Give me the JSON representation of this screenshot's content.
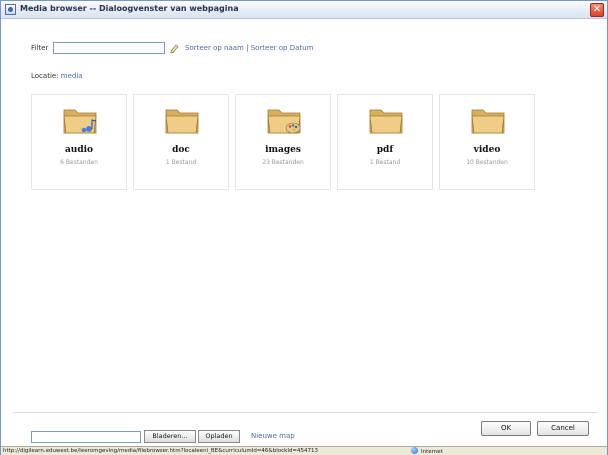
{
  "window": {
    "title": "Media browser -- Dialoogvenster van webpagina",
    "close_glyph": "✕"
  },
  "filter": {
    "label": "Filter",
    "value": "",
    "sort_by_name": "Sorteer op naam",
    "separator": "|",
    "sort_by_date": "Sorteer op Datum"
  },
  "location": {
    "label": "Locatie:",
    "path": "media"
  },
  "folders": [
    {
      "name": "audio",
      "count": "6 Bestanden",
      "icon": "folder-audio-icon"
    },
    {
      "name": "doc",
      "count": "1 Bestand",
      "icon": "folder-icon"
    },
    {
      "name": "images",
      "count": "23 Bestanden",
      "icon": "folder-images-icon"
    },
    {
      "name": "pdf",
      "count": "1 Bestand",
      "icon": "folder-icon"
    },
    {
      "name": "video",
      "count": "10 Bestanden",
      "icon": "folder-icon"
    }
  ],
  "footer": {
    "ok_label": "OK",
    "cancel_label": "Cancel",
    "browse_label": "Bladeren...",
    "upload_label": "Opladen",
    "new_folder_label": "Nieuwe map"
  },
  "status": {
    "url": "http://digilearn.eduwest.be/leeromgeving/media/filebrowser.htm?localeeni_BE&curriculumId=46&blockId=454713",
    "zone": "Internet"
  },
  "colors": {
    "link": "#4a6fa5",
    "folder": "#e0b86a"
  }
}
